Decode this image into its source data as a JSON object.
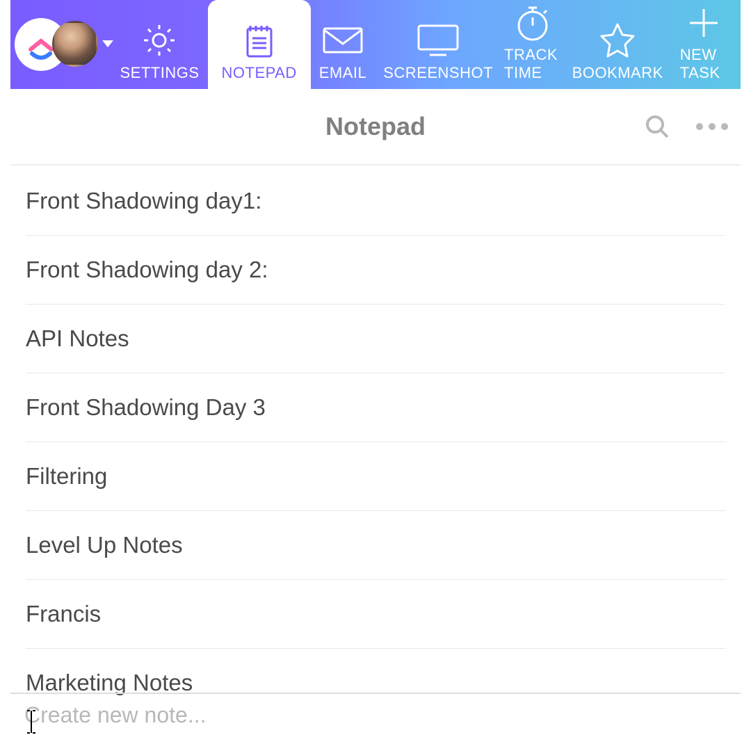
{
  "header": {
    "tabs": [
      {
        "icon": "gear-icon",
        "label": "SETTINGS",
        "active": false
      },
      {
        "icon": "notepad-icon",
        "label": "NOTEPAD",
        "active": true
      },
      {
        "icon": "mail-icon",
        "label": "EMAIL",
        "active": false
      },
      {
        "icon": "monitor-icon",
        "label": "SCREENSHOT",
        "active": false
      },
      {
        "icon": "stopwatch-icon",
        "label": "TRACK TIME",
        "active": false
      },
      {
        "icon": "star-icon",
        "label": "BOOKMARK",
        "active": false
      },
      {
        "icon": "plus-icon",
        "label": "NEW TASK",
        "active": false
      }
    ]
  },
  "page_title": "Notepad",
  "notes": [
    "Front Shadowing day1:",
    "Front Shadowing day 2:",
    "API Notes",
    "Front Shadowing Day 3",
    "Filtering",
    "Level Up Notes",
    "Francis",
    "Marketing Notes"
  ],
  "create_placeholder": "Create new note..."
}
